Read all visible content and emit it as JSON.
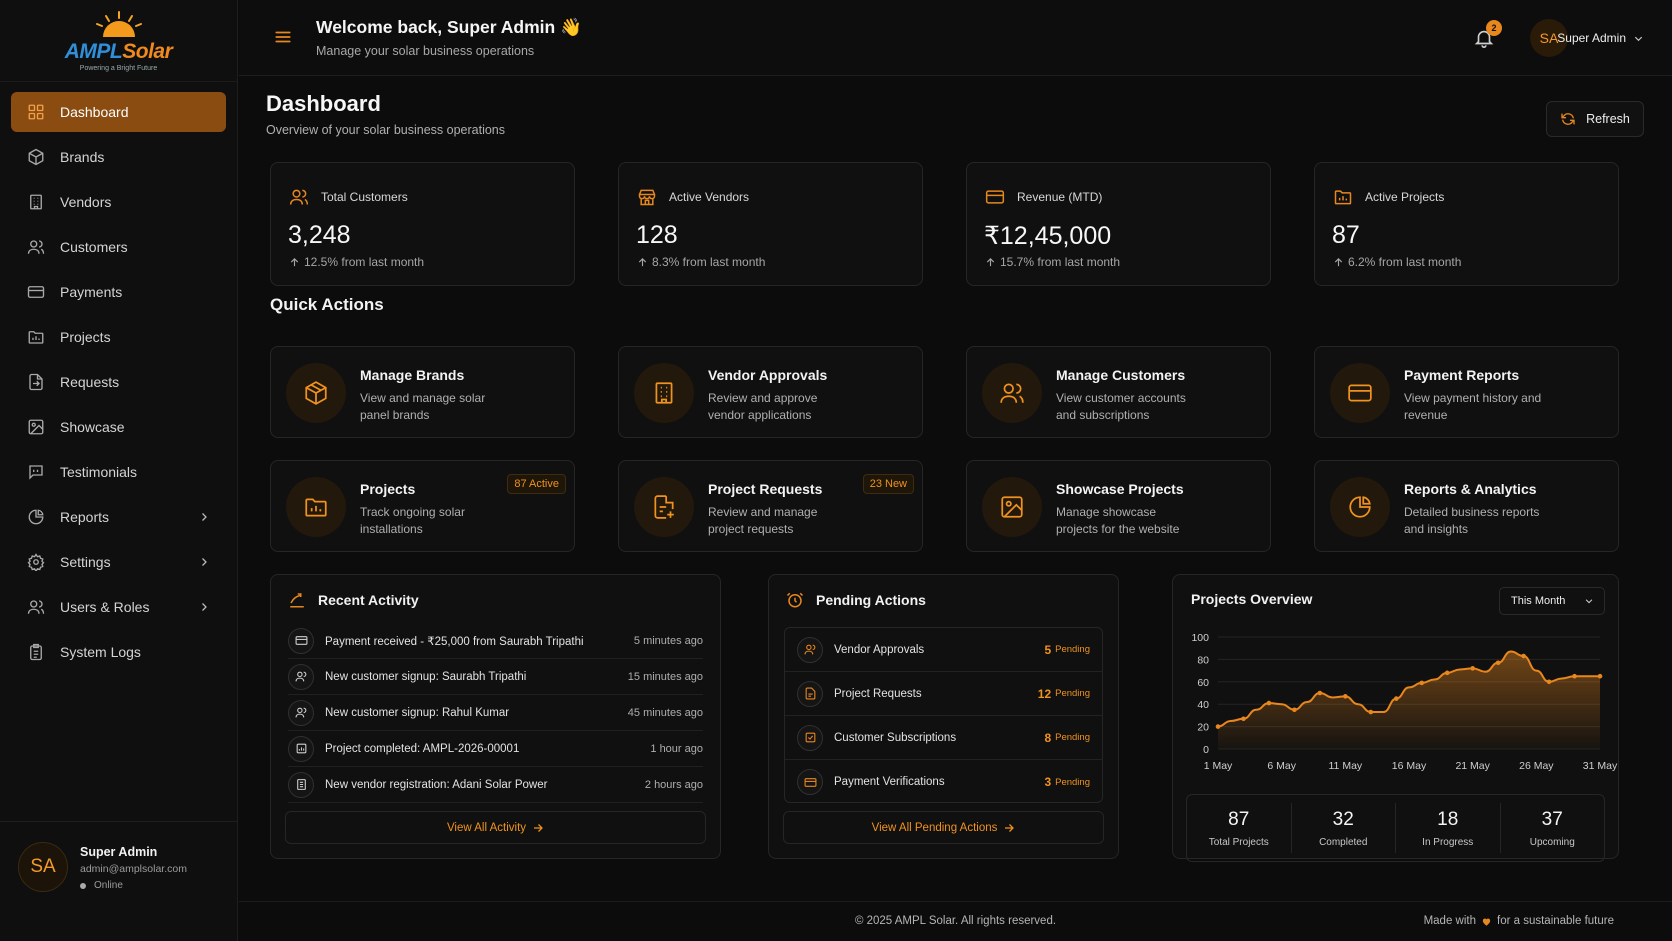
{
  "brand": {
    "name_part1": "AMPL",
    "name_part2": "Solar",
    "tagline": "Powering a Bright Future"
  },
  "sidebar": {
    "items": [
      {
        "label": "Dashboard",
        "icon": "grid-icon",
        "active": true
      },
      {
        "label": "Brands",
        "icon": "box-icon"
      },
      {
        "label": "Vendors",
        "icon": "building-icon"
      },
      {
        "label": "Customers",
        "icon": "users-icon"
      },
      {
        "label": "Payments",
        "icon": "card-icon"
      },
      {
        "label": "Projects",
        "icon": "folder-chart-icon"
      },
      {
        "label": "Requests",
        "icon": "file-arrow-icon"
      },
      {
        "label": "Showcase",
        "icon": "image-icon"
      },
      {
        "label": "Testimonials",
        "icon": "quote-icon"
      },
      {
        "label": "Reports",
        "icon": "pie-chart-icon",
        "expandable": true
      },
      {
        "label": "Settings",
        "icon": "gear-icon",
        "expandable": true
      },
      {
        "label": "Users & Roles",
        "icon": "users-roles-icon",
        "expandable": true
      },
      {
        "label": "System Logs",
        "icon": "clipboard-icon"
      }
    ],
    "user": {
      "initials": "SA",
      "name": "Super Admin",
      "email": "admin@amplsolar.com",
      "status": "Online"
    }
  },
  "header": {
    "welcome": "Welcome back, Super Admin 👋",
    "subtitle": "Manage your solar business operations",
    "notifications": "2",
    "user_initials": "SA",
    "user_name": "Super Admin"
  },
  "page": {
    "title": "Dashboard",
    "subtitle": "Overview of your solar business operations",
    "refresh_label": "Refresh"
  },
  "stats": [
    {
      "label": "Total Customers",
      "value": "3,248",
      "trend": "12.5% from last month",
      "icon": "users-icon"
    },
    {
      "label": "Active Vendors",
      "value": "128",
      "trend": "8.3% from last month",
      "icon": "store-icon"
    },
    {
      "label": "Revenue (MTD)",
      "value": "₹12,45,000",
      "trend": "15.7% from last month",
      "icon": "card-icon"
    },
    {
      "label": "Active Projects",
      "value": "87",
      "trend": "6.2% from last month",
      "icon": "folder-chart-icon"
    }
  ],
  "quick_actions": {
    "title": "Quick Actions",
    "items": [
      {
        "title": "Manage Brands",
        "desc": "View and manage solar panel brands",
        "icon": "box-icon"
      },
      {
        "title": "Vendor Approvals",
        "desc": "Review and approve vendor applications",
        "icon": "building-icon"
      },
      {
        "title": "Manage Customers",
        "desc": "View customer accounts and subscriptions",
        "icon": "users-icon"
      },
      {
        "title": "Payment Reports",
        "desc": "View payment history and revenue",
        "icon": "card-icon"
      },
      {
        "title": "Projects",
        "desc": "Track ongoing solar installations",
        "badge": "87 Active",
        "icon": "folder-chart-icon"
      },
      {
        "title": "Project Requests",
        "desc": "Review and manage project requests",
        "badge": "23 New",
        "icon": "file-plus-icon"
      },
      {
        "title": "Showcase Projects",
        "desc": "Manage showcase projects for the website",
        "icon": "image-icon"
      },
      {
        "title": "Reports & Analytics",
        "desc": "Detailed business reports and insights",
        "icon": "pie-chart-icon"
      }
    ]
  },
  "recent_activity": {
    "title": "Recent Activity",
    "items": [
      {
        "text": "Payment received - ₹25,000 from Saurabh Tripathi",
        "time": "5 minutes ago",
        "icon": "card-icon"
      },
      {
        "text": "New customer signup: Saurabh Tripathi",
        "time": "15 minutes ago",
        "icon": "users-icon"
      },
      {
        "text": "New customer signup: Rahul Kumar",
        "time": "45 minutes ago",
        "icon": "users-icon"
      },
      {
        "text": "Project completed: AMPL-2026-00001",
        "time": "1 hour ago",
        "icon": "folder-chart-icon"
      },
      {
        "text": "New vendor registration: Adani Solar Power",
        "time": "2 hours ago",
        "icon": "building-icon"
      }
    ],
    "view_all": "View All Activity"
  },
  "pending_actions": {
    "title": "Pending Actions",
    "items": [
      {
        "label": "Vendor Approvals",
        "count": "5",
        "status": "Pending",
        "icon": "users-icon"
      },
      {
        "label": "Project Requests",
        "count": "12",
        "status": "Pending",
        "icon": "file-icon"
      },
      {
        "label": "Customer Subscriptions",
        "count": "8",
        "status": "Pending",
        "icon": "subscription-icon"
      },
      {
        "label": "Payment Verifications",
        "count": "3",
        "status": "Pending",
        "icon": "card-icon"
      }
    ],
    "view_all": "View All Pending Actions"
  },
  "projects_overview": {
    "title": "Projects Overview",
    "period": "This Month",
    "stats": [
      {
        "value": "87",
        "label": "Total Projects"
      },
      {
        "value": "32",
        "label": "Completed"
      },
      {
        "value": "18",
        "label": "In Progress"
      },
      {
        "value": "37",
        "label": "Upcoming"
      }
    ]
  },
  "chart_data": {
    "type": "area",
    "x": [
      1,
      2,
      3,
      4,
      5,
      6,
      7,
      8,
      9,
      10,
      11,
      12,
      13,
      14,
      15,
      16,
      17,
      18,
      19,
      20,
      21,
      22,
      23,
      24,
      25,
      26,
      27,
      28,
      29,
      30,
      31
    ],
    "x_ticks": [
      1,
      6,
      11,
      16,
      21,
      26,
      31
    ],
    "x_tick_labels": [
      "1 May",
      "6 May",
      "11 May",
      "16 May",
      "21 May",
      "26 May",
      "31 May"
    ],
    "y_ticks": [
      0,
      20,
      40,
      60,
      80,
      100
    ],
    "series": [
      {
        "values": [
          20,
          25,
          27,
          35,
          41,
          40,
          35,
          42,
          50,
          46,
          47,
          40,
          33,
          33,
          45,
          55,
          59,
          62,
          68,
          71,
          72,
          69,
          77,
          87,
          83,
          70,
          60,
          63,
          65,
          65,
          65
        ]
      }
    ],
    "ylim": [
      0,
      100
    ],
    "color": "#e8871e"
  },
  "footer": {
    "copyright": "© 2025 AMPL Solar. All rights reserved.",
    "made_prefix": "Made with",
    "made_suffix": "for a sustainable future"
  }
}
